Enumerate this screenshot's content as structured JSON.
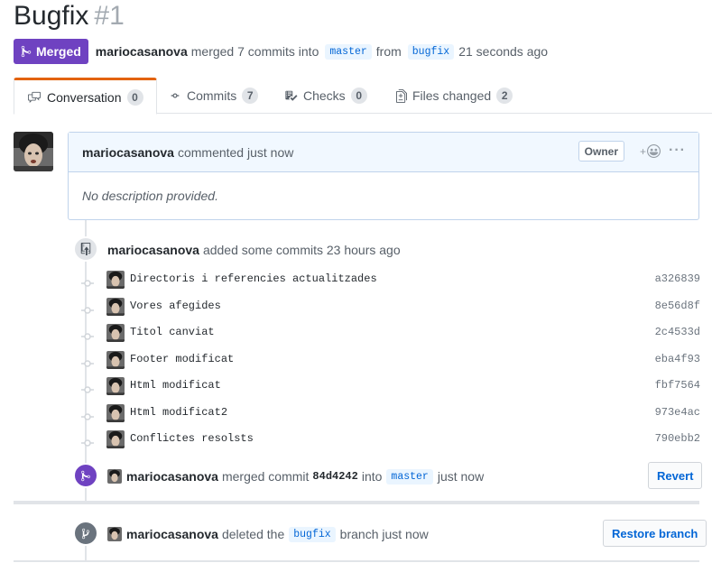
{
  "pr": {
    "title": "Bugfix",
    "number": "#1",
    "status": "Merged",
    "author": "mariocasanova",
    "merged_text": "merged 7 commits into",
    "base_branch": "master",
    "from_text": "from",
    "head_branch": "bugfix",
    "time": "21 seconds ago"
  },
  "tabs": [
    {
      "label": "Conversation",
      "count": "0",
      "icon": "comment-discussion-icon"
    },
    {
      "label": "Commits",
      "count": "7",
      "icon": "git-commit-icon"
    },
    {
      "label": "Checks",
      "count": "0",
      "icon": "checklist-icon"
    },
    {
      "label": "Files changed",
      "count": "2",
      "icon": "file-diff-icon"
    }
  ],
  "comment": {
    "author": "mariocasanova",
    "action": "commented just now",
    "role": "Owner",
    "reaction_icon": "smiley-icon",
    "more": "···",
    "body": "No description provided."
  },
  "commits_event": {
    "author": "mariocasanova",
    "text": "added some commits 23 hours ago"
  },
  "commits": [
    {
      "message": "Directoris i referencies actualitzades",
      "sha": "a326839"
    },
    {
      "message": "Vores afegides",
      "sha": "8e56d8f"
    },
    {
      "message": "Titol canviat",
      "sha": "2c4533d"
    },
    {
      "message": "Footer modificat",
      "sha": "eba4f93"
    },
    {
      "message": "Html modificat",
      "sha": "fbf7564"
    },
    {
      "message": "Html modificat2",
      "sha": "973e4ac"
    },
    {
      "message": "Conflictes resolsts",
      "sha": "790ebb2"
    }
  ],
  "merge_event": {
    "author": "mariocasanova",
    "text1": "merged commit",
    "sha": "84d4242",
    "text2": "into",
    "branch": "master",
    "text3": "just now",
    "button": "Revert"
  },
  "delete_event": {
    "author": "mariocasanova",
    "text1": "deleted the",
    "branch": "bugfix",
    "text2": "branch just now",
    "button": "Restore branch"
  },
  "colors": {
    "merged_purple": "#6f42c1",
    "tab_accent": "#e36209",
    "link_blue": "#0366d6"
  }
}
